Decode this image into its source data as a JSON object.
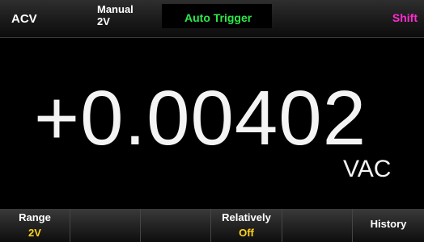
{
  "status": {
    "function": "ACV",
    "range_mode": "Manual",
    "range_value": "2V",
    "trigger": "Auto Trigger",
    "shift": "Shift"
  },
  "reading": {
    "value": "+0.00402",
    "unit": "VAC"
  },
  "softkeys": [
    {
      "label": "Range",
      "value": "2V"
    },
    {
      "label": "",
      "value": ""
    },
    {
      "label": "",
      "value": ""
    },
    {
      "label": "Relatively",
      "value": "Off"
    },
    {
      "label": "",
      "value": ""
    },
    {
      "label": "History",
      "value": ""
    }
  ],
  "colors": {
    "trigger": "#2de84a",
    "shift": "#ff2bd0",
    "softkey_value": "#ffd21a",
    "reading": "#f4f4f4"
  }
}
